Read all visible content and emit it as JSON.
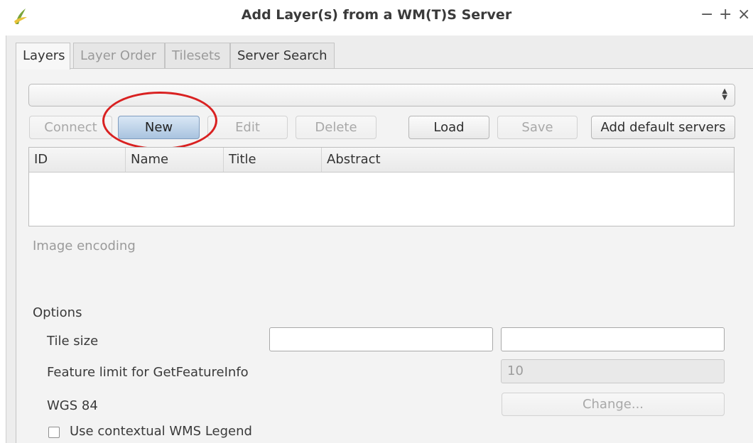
{
  "window": {
    "title": "Add Layer(s) from a WM(T)S Server",
    "controls": {
      "minimize": "−",
      "maximize": "+",
      "close": "×"
    }
  },
  "tabs": [
    {
      "label": "Layers",
      "active": true
    },
    {
      "label": "Layer Order",
      "active": false
    },
    {
      "label": "Tilesets",
      "active": false
    },
    {
      "label": "Server Search",
      "active": false
    }
  ],
  "server_combo": {
    "value": ""
  },
  "buttons": {
    "connect": "Connect",
    "new": "New",
    "edit": "Edit",
    "delete": "Delete",
    "load": "Load",
    "save": "Save",
    "add_default": "Add default servers"
  },
  "layers_table": {
    "columns": [
      "ID",
      "Name",
      "Title",
      "Abstract"
    ],
    "rows": []
  },
  "image_encoding_label": "Image encoding",
  "options": {
    "heading": "Options",
    "tile_size_label": "Tile size",
    "tile_width": "",
    "tile_height": "",
    "feature_limit_label": "Feature limit for GetFeatureInfo",
    "feature_limit_value": "10",
    "crs_label": "WGS 84",
    "change_button": "Change...",
    "contextual_legend_label": "Use contextual WMS Legend",
    "contextual_legend_checked": false
  },
  "colors": {
    "annotation": "#d92121",
    "primary_button": "#a9c3df"
  }
}
